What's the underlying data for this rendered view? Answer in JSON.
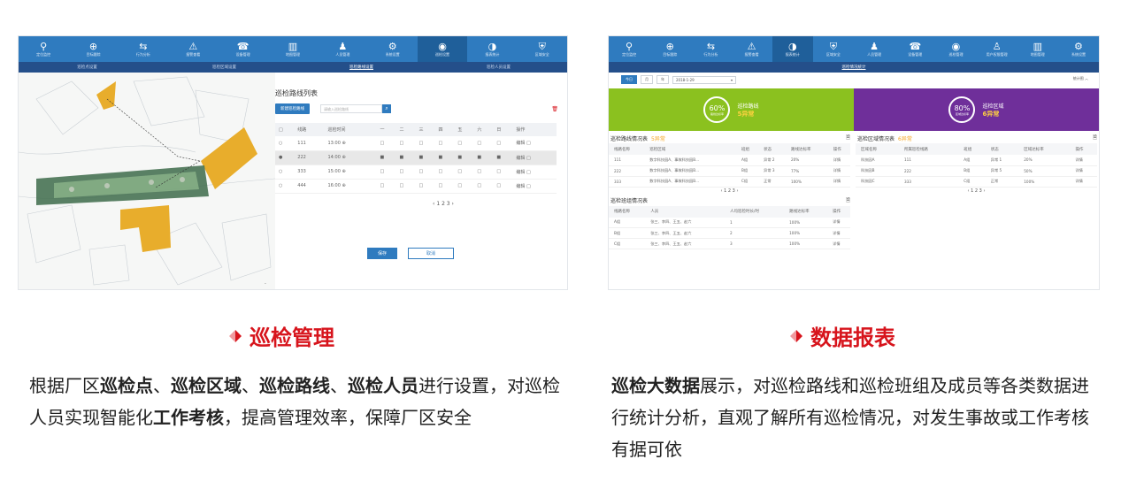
{
  "left_panel": {
    "nav_items": [
      {
        "icon": "location-pin-icon",
        "glyph": "⚲",
        "label": "定位监控"
      },
      {
        "icon": "crosshair-icon",
        "glyph": "⊕",
        "label": "目标跟踪"
      },
      {
        "icon": "route-icon",
        "glyph": "⇆",
        "label": "行为分析"
      },
      {
        "icon": "warning-icon",
        "glyph": "⚠",
        "label": "报警查看"
      },
      {
        "icon": "device-icon",
        "glyph": "☎",
        "label": "设备管理"
      },
      {
        "icon": "map-icon",
        "glyph": "▥",
        "label": "地图管理"
      },
      {
        "icon": "people-icon",
        "glyph": "♟",
        "label": "人员管理"
      },
      {
        "icon": "settings-icon",
        "glyph": "⚙",
        "label": "系统设置"
      },
      {
        "icon": "patrol-icon",
        "glyph": "◉",
        "label": "巡检设置"
      },
      {
        "icon": "report-icon",
        "glyph": "◑",
        "label": "报表统计"
      },
      {
        "icon": "shield-icon",
        "glyph": "⛨",
        "label": "区域安全"
      }
    ],
    "active_nav": 8,
    "sub_nav": [
      "巡检点设置",
      "巡检区域设置",
      "巡检路线设置",
      "巡检人员设置"
    ],
    "active_sub": 2,
    "list_title": "巡检路线列表",
    "new_route_button": "新建巡检路线",
    "search_placeholder": "请输入巡检路线",
    "table_headers": [
      "线路",
      "巡检时间",
      "一",
      "二",
      "三",
      "四",
      "五",
      "六",
      "日",
      "操作"
    ],
    "rows": [
      {
        "route": "111",
        "time": "13:00",
        "action": "编辑",
        "selected": false
      },
      {
        "route": "222",
        "time": "14:00",
        "action": "编辑",
        "selected": true
      },
      {
        "route": "333",
        "time": "15:00",
        "action": "编辑",
        "selected": false
      },
      {
        "route": "444",
        "time": "16:00",
        "action": "编辑",
        "selected": false
      }
    ],
    "pager": "‹ 1 2 3 ›",
    "save_button": "保存",
    "cancel_button": "取消"
  },
  "right_panel": {
    "nav_items": [
      {
        "icon": "location-pin-icon",
        "glyph": "⚲",
        "label": "定位监控"
      },
      {
        "icon": "crosshair-icon",
        "glyph": "⊕",
        "label": "目标跟踪"
      },
      {
        "icon": "route-icon",
        "glyph": "⇆",
        "label": "行为分析"
      },
      {
        "icon": "warning-icon",
        "glyph": "⚠",
        "label": "报警查看"
      },
      {
        "icon": "report-icon",
        "glyph": "◑",
        "label": "报表统计"
      },
      {
        "icon": "shield-icon",
        "glyph": "⛨",
        "label": "区域安全"
      },
      {
        "icon": "people-icon",
        "glyph": "♟",
        "label": "人员管理"
      },
      {
        "icon": "device-icon",
        "glyph": "☎",
        "label": "设备管理"
      },
      {
        "icon": "patrol-icon",
        "glyph": "◉",
        "label": "巡检管理"
      },
      {
        "icon": "person-icon",
        "glyph": "♙",
        "label": "用户权限管理"
      },
      {
        "icon": "map-icon",
        "glyph": "▥",
        "label": "地图管理"
      },
      {
        "icon": "settings-icon",
        "glyph": "⚙",
        "label": "系统设置"
      }
    ],
    "active_nav": 4,
    "sub_nav": [
      "巡检情况统计"
    ],
    "date_buttons": [
      "今日",
      "月",
      "年"
    ],
    "date_value": "2018-1-29",
    "stat_link": "统计图 ︿",
    "kpi_route": {
      "pct": "60%",
      "sub": "路线达标率",
      "title": "巡检路线",
      "value": "5异常"
    },
    "kpi_area": {
      "pct": "80%",
      "sub": "区域达标率",
      "title": "巡检区域",
      "value": "6异常"
    },
    "route_report": {
      "title": "巡检路线情况表",
      "warn": "5异常",
      "headers": [
        "线路名称",
        "巡检区域",
        "班组",
        "状态",
        "路线达标率",
        "操作"
      ],
      "rows": [
        [
          "111",
          "数字科技园A、事故科技园B...",
          "A组",
          "异常 2",
          "20%",
          "详情"
        ],
        [
          "222",
          "数字科技园A、事故科技园B...",
          "B组",
          "异常 3",
          "77%",
          "详情"
        ],
        [
          "333",
          "数字科技园A、事故科技园B...",
          "C组",
          "正常",
          "100%",
          "详情"
        ]
      ],
      "pager": "‹ 1 2 3 ›"
    },
    "area_report": {
      "title": "巡检区域情况表",
      "warn": "6异常",
      "headers": [
        "区域名称",
        "所属巡检线路",
        "班组",
        "状态",
        "区域达标率",
        "操作"
      ],
      "rows": [
        [
          "科技园A",
          "111",
          "A组",
          "异常 1",
          "20%",
          "详情"
        ],
        [
          "科技园B",
          "222",
          "B组",
          "异常 5",
          "50%",
          "详情"
        ],
        [
          "科技园C",
          "333",
          "C组",
          "正常",
          "100%",
          "详情"
        ]
      ],
      "pager": "‹ 1 2 3 ›"
    },
    "team_report": {
      "title": "巡检班组情况表",
      "headers": [
        "线路名称",
        "人员",
        "人均巡检时长/时",
        "路线达标率",
        "操作"
      ],
      "rows": [
        [
          "A组",
          "张三、李四、王五、赵六",
          "1",
          "100%",
          "详情"
        ],
        [
          "B组",
          "张三、李四、王五、赵六",
          "2",
          "100%",
          "详情"
        ],
        [
          "C组",
          "张三、李四、王五、赵六",
          "3",
          "100%",
          "详情"
        ]
      ]
    }
  },
  "captions": {
    "left_title": "巡检管理",
    "right_title": "数据报表",
    "left_body": [
      {
        "t": "根据厂区",
        "b": false
      },
      {
        "t": "巡检点",
        "b": true
      },
      {
        "t": "、",
        "b": false
      },
      {
        "t": "巡检区域",
        "b": true
      },
      {
        "t": "、",
        "b": false
      },
      {
        "t": "巡检路线",
        "b": true
      },
      {
        "t": "、",
        "b": false
      },
      {
        "t": "巡检人员",
        "b": true
      },
      {
        "t": "进行设置，对巡检人员实现智能化",
        "b": false
      },
      {
        "t": "工作考核",
        "b": true
      },
      {
        "t": "，提高管理效率，保障厂区安全",
        "b": false
      }
    ],
    "right_body": [
      {
        "t": "巡检大数据",
        "b": true
      },
      {
        "t": "展示，对巡检路线和巡检班组及成员等各类数据进行统计分析，直观了解所有巡检情况，对发生事故或工作考核有据可依",
        "b": false
      }
    ]
  },
  "colors": {
    "nav": "#2f7bbf",
    "accent_red": "#d7141c",
    "kpi_green": "#8bc11f",
    "kpi_purple": "#6f2f9a",
    "warn": "#f5a623"
  }
}
